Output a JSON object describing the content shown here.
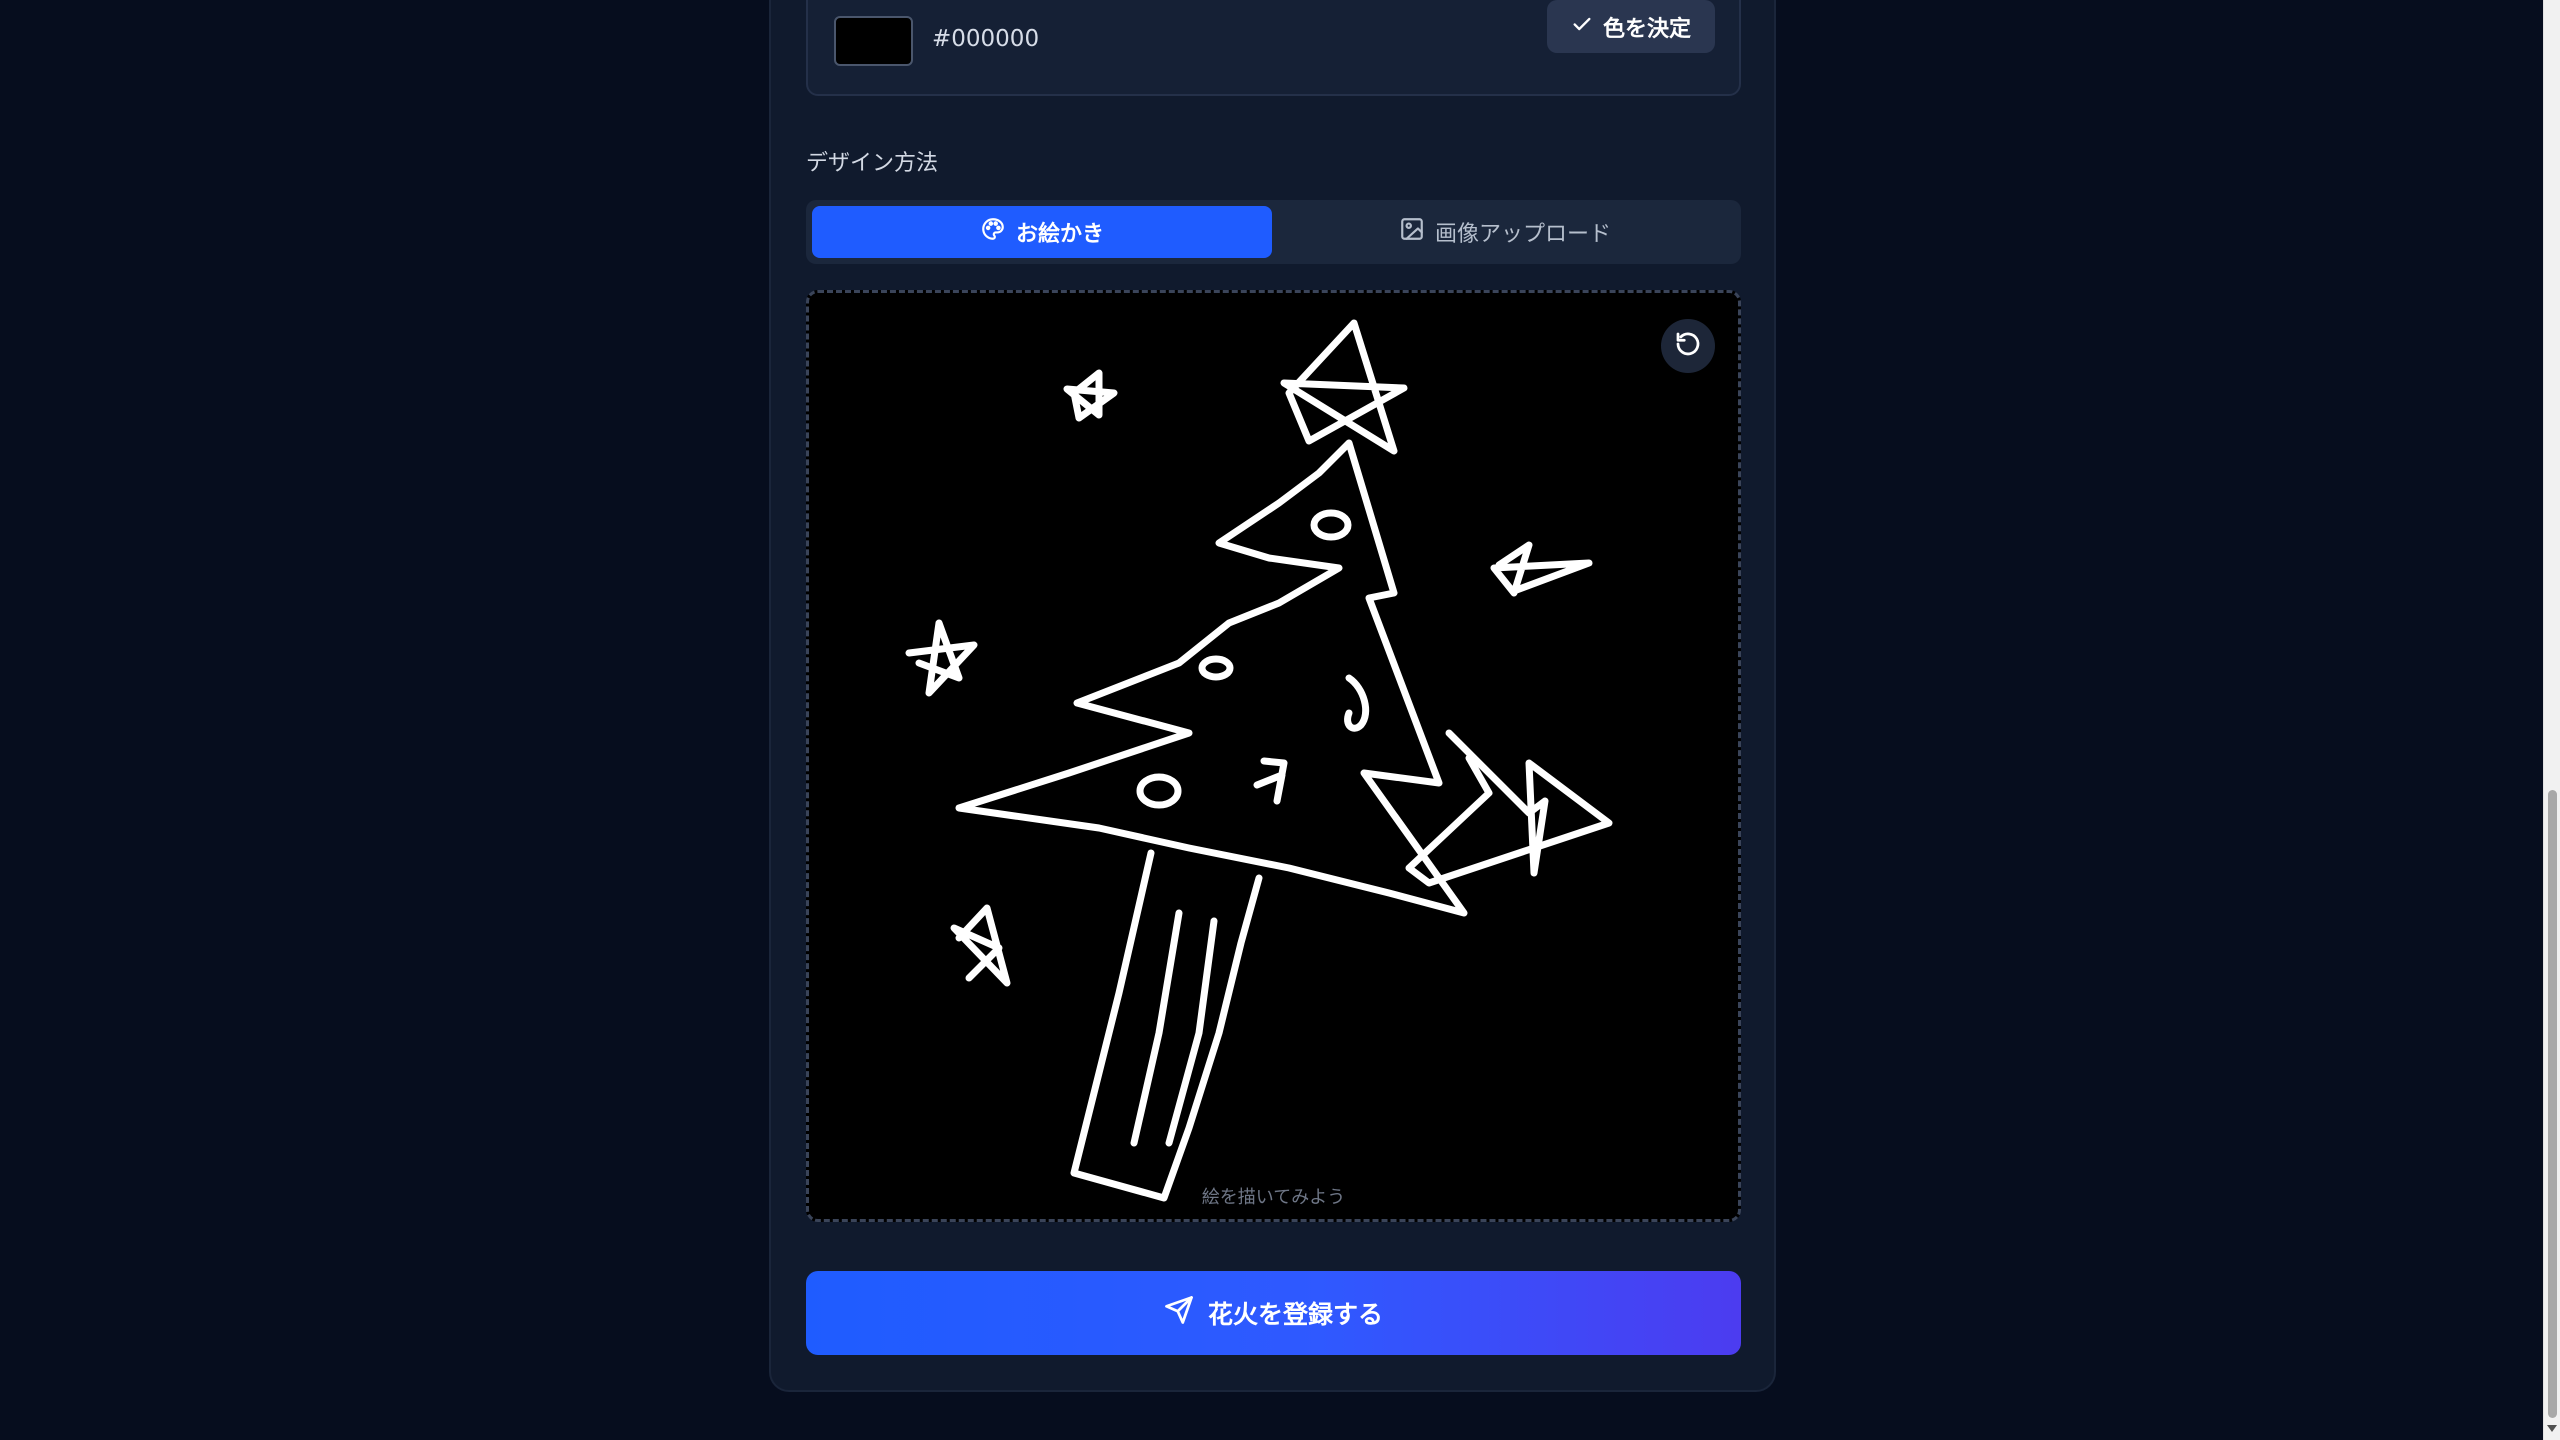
{
  "color_picker": {
    "hex_value": "#000000",
    "confirm_label": "色を決定"
  },
  "design_method": {
    "label": "デザイン方法",
    "tabs": [
      {
        "label": "お絵かき",
        "active": true,
        "icon": "palette-icon"
      },
      {
        "label": "画像アップロード",
        "active": false,
        "icon": "image-icon"
      }
    ]
  },
  "canvas": {
    "placeholder": "絵を描いてみよう",
    "stroke_color": "#ffffff",
    "background_color": "#000000",
    "reset_icon": "reset-icon"
  },
  "submit": {
    "label": "花火を登録する",
    "icon": "send-icon"
  },
  "colors": {
    "accent": "#1f5cff",
    "accent_end": "#4c3cf0"
  }
}
